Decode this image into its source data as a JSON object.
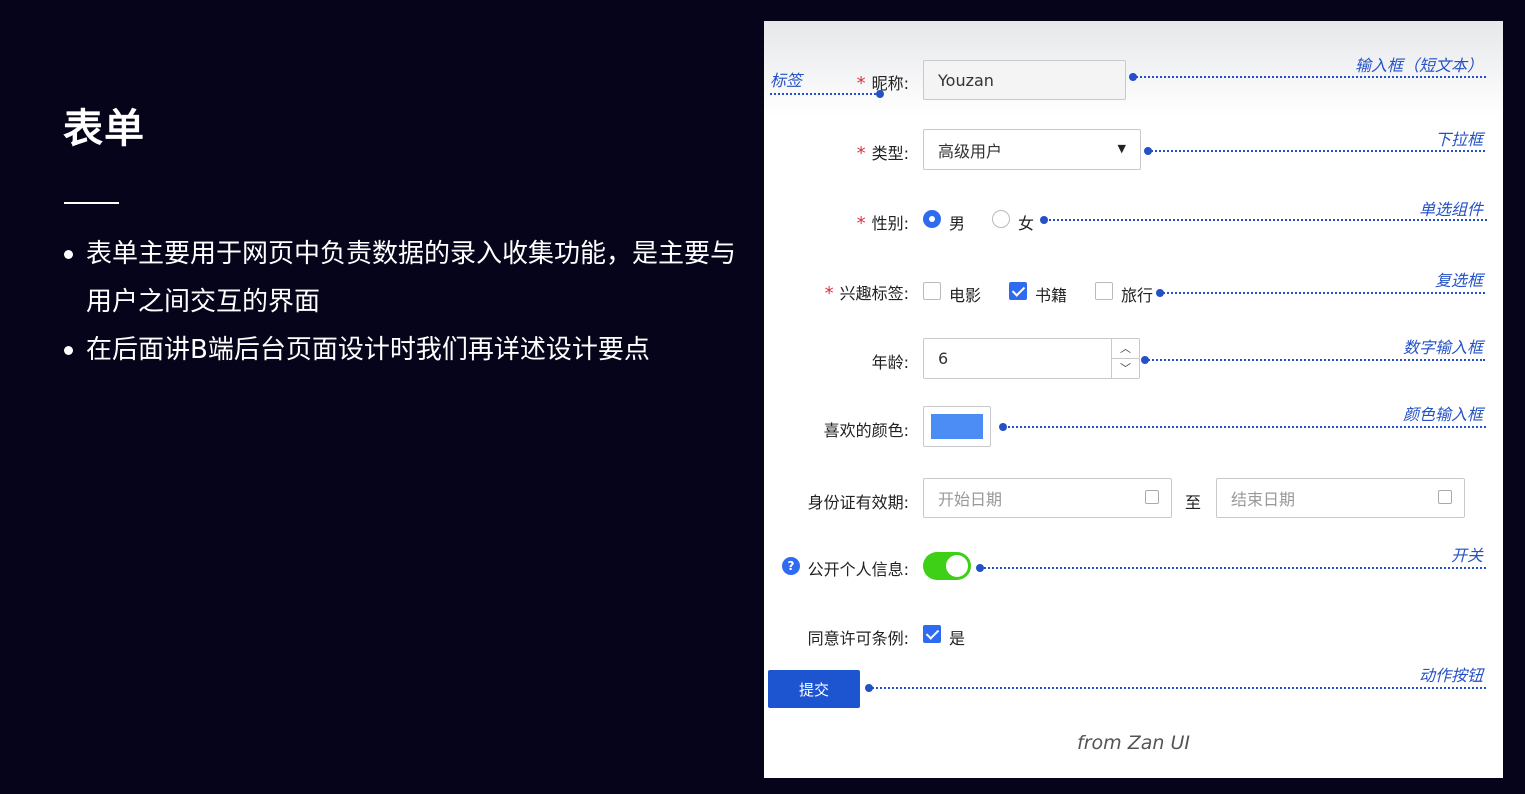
{
  "slide": {
    "title": "表单",
    "bullets": [
      "表单主要用于网页中负责数据的录入收集功能，是主要与用户之间交互的界面",
      "在后面讲B端后台页面设计时我们再详述设计要点"
    ]
  },
  "form": {
    "required_mark": "*",
    "nickname": {
      "label": "昵称:",
      "value": "Youzan",
      "annotation": "输入框（短文本）",
      "label_annotation": "标签"
    },
    "type": {
      "label": "类型:",
      "selected": "高级用户",
      "annotation": "下拉框"
    },
    "gender": {
      "label": "性别:",
      "options": [
        "男",
        "女"
      ],
      "selected": "男",
      "annotation": "单选组件"
    },
    "interests": {
      "label": "兴趣标签:",
      "options": [
        "电影",
        "书籍",
        "旅行"
      ],
      "checked": [
        "书籍"
      ],
      "annotation": "复选框"
    },
    "age": {
      "label": "年龄:",
      "value": "6",
      "annotation": "数字输入框"
    },
    "color": {
      "label": "喜欢的颜色:",
      "value": "#4b8cf5",
      "annotation": "颜色输入框"
    },
    "id_validity": {
      "label": "身份证有效期:",
      "start_placeholder": "开始日期",
      "separator": "至",
      "end_placeholder": "结束日期"
    },
    "public_info": {
      "label": "公开个人信息:",
      "on": true,
      "annotation": "开关",
      "help": "?"
    },
    "agree": {
      "label": "同意许可条例:",
      "option": "是",
      "checked": true
    },
    "submit": {
      "label": "提交",
      "annotation": "动作按钮"
    },
    "credit": "from Zan UI"
  }
}
